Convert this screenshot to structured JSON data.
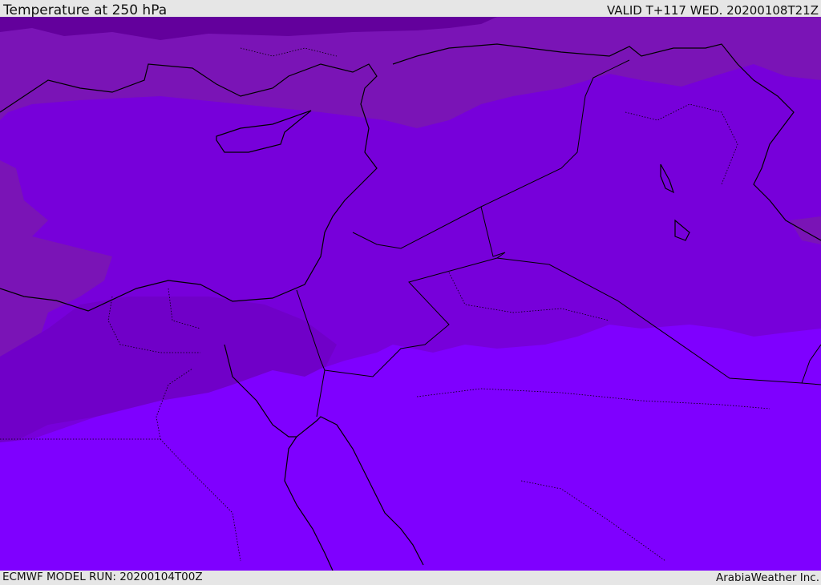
{
  "header": {
    "title": "Temperature at 250 hPa",
    "valid": "VALID T+117 WED. 20200108T21Z"
  },
  "footer": {
    "model_run": "ECMWF MODEL RUN: 20200104T00Z",
    "credit": "ArabiaWeather Inc."
  },
  "colors": {
    "coldest": "#63009c",
    "cold": "#7a14b6",
    "mid": "#7700da",
    "warm": "#7f00ff",
    "boundary": "#000000"
  }
}
